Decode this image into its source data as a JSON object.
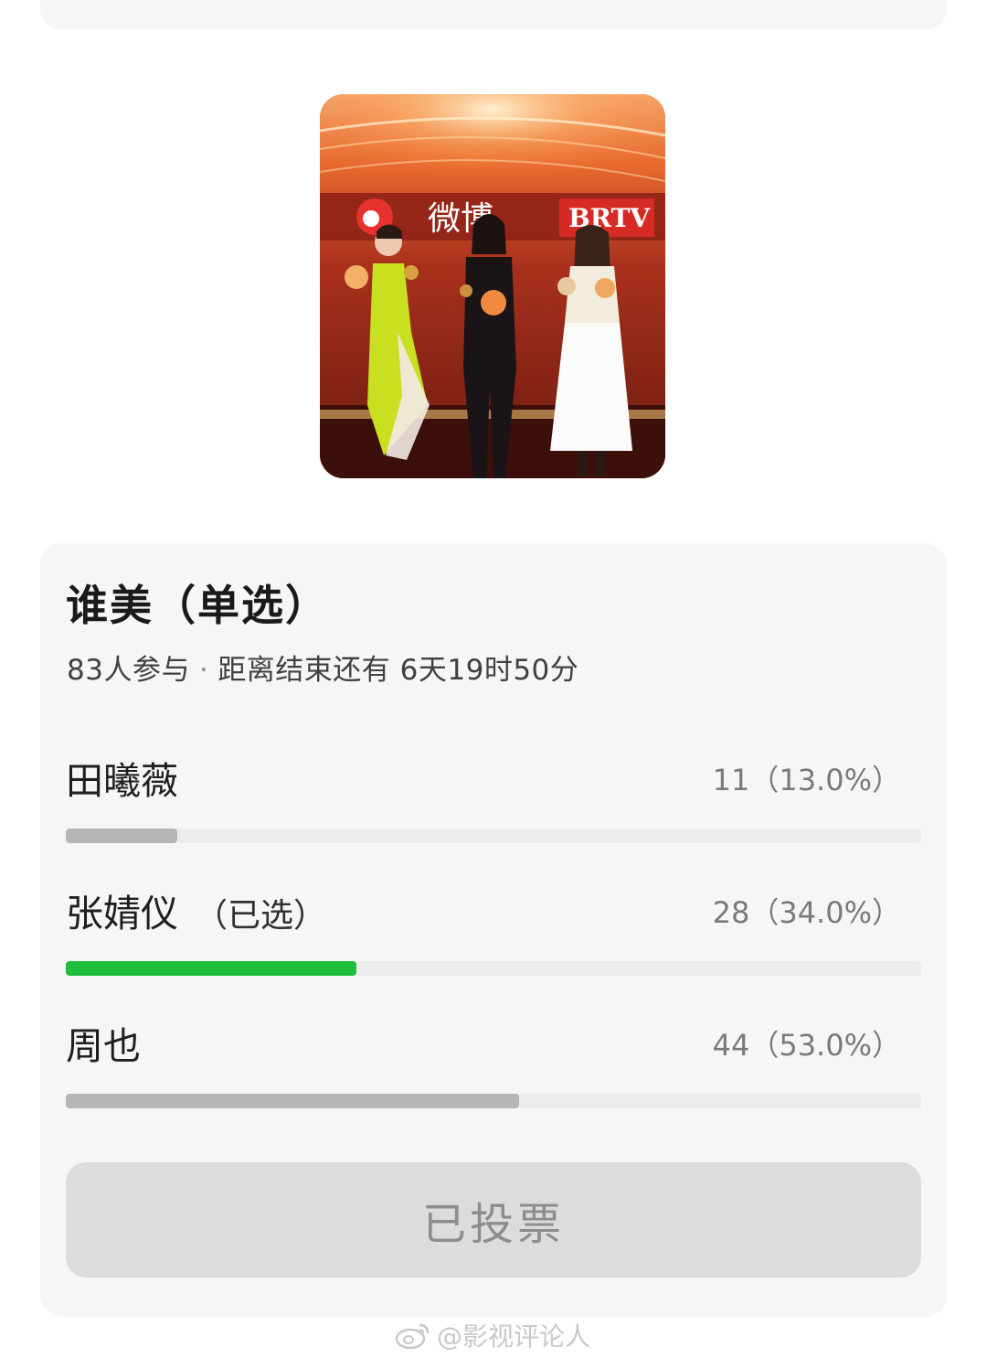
{
  "photo": {
    "logo_text": "微博",
    "channel_text": "BRTV"
  },
  "poll": {
    "title": "谁美（单选）",
    "participants": "83人参与",
    "separator": "·",
    "time_left": "距离结束还有 6天19时50分",
    "options": [
      {
        "name": "田曦薇",
        "selected_label": "",
        "count": "11（13.0%）",
        "fraction": 0.13,
        "selected": false
      },
      {
        "name": "张婧仪",
        "selected_label": "（已选）",
        "count": "28（34.0%）",
        "fraction": 0.34,
        "selected": true
      },
      {
        "name": "周也",
        "selected_label": "",
        "count": "44（53.0%）",
        "fraction": 0.53,
        "selected": false
      }
    ],
    "voted_button": "已投票"
  },
  "watermark": {
    "text": "@影视评论人"
  },
  "colors": {
    "selected_bar": "#1fbf3d",
    "unselected_bar": "#b5b5b5",
    "card_bg": "#f6f6f6"
  }
}
